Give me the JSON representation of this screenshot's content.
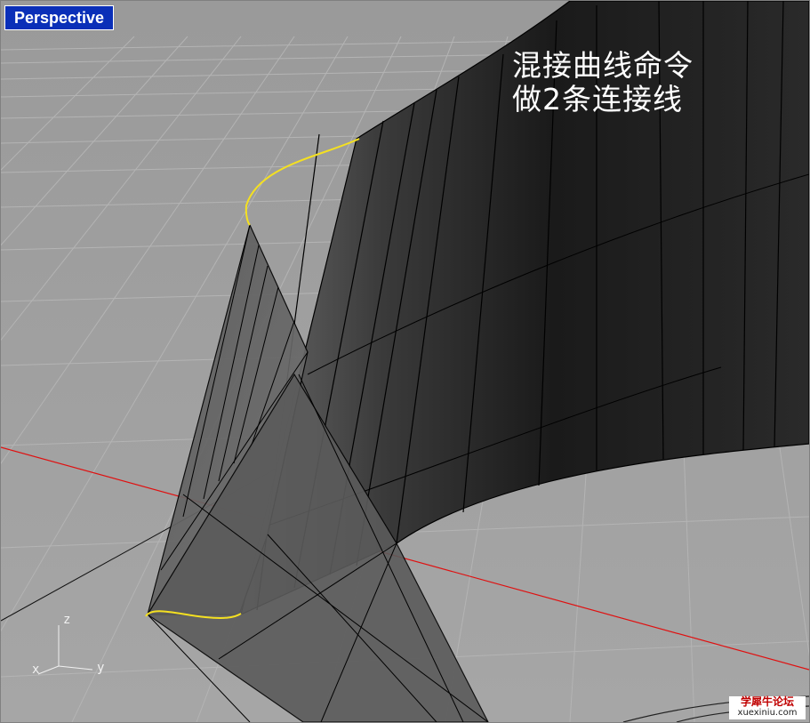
{
  "viewport": {
    "title": "Perspective"
  },
  "annotation": {
    "line1": "混接曲线命令",
    "line2": "做2条连接线"
  },
  "axes": {
    "z_label": "z",
    "x_label": "x",
    "y_label": "y"
  },
  "colors": {
    "background": "#9c9c9c",
    "grid": "#b3b3b3",
    "surface_dark": "#1c1c1c",
    "surface_mid": "#5a5a5a",
    "blend_curve": "#f4e021",
    "x_axis": "#e01010",
    "title_bar": "#0a2fb8"
  },
  "watermark": {
    "top": "学犀牛论坛",
    "bottom": "xuexiniu.com"
  }
}
